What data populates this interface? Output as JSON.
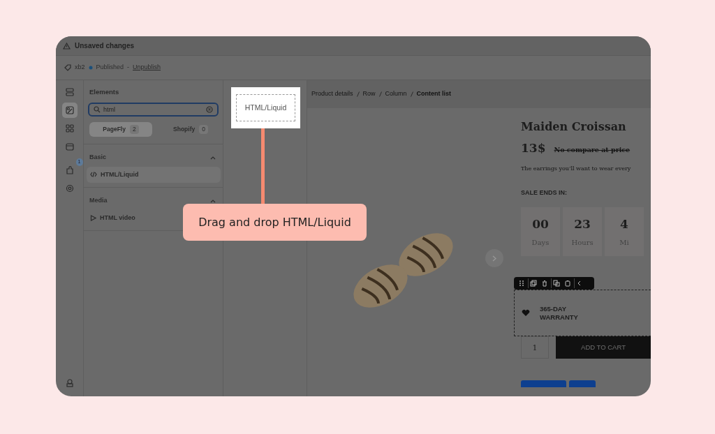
{
  "banner": {
    "title": "Unsaved changes"
  },
  "page_bar": {
    "page_name": "xb2",
    "status": "Published",
    "separator": "-",
    "action": "Unpublish"
  },
  "rail": {
    "items": [
      {
        "selected": false
      },
      {
        "selected": true
      },
      {
        "selected": false
      },
      {
        "selected": false
      },
      {
        "selected": false,
        "badge": "1"
      },
      {
        "selected": false
      }
    ]
  },
  "elements_panel": {
    "title": "Elements",
    "search": {
      "value": "html"
    },
    "filters": [
      {
        "label": "PageFly",
        "count": "2",
        "selected": true
      },
      {
        "label": "Shopify",
        "count": "0",
        "selected": false
      }
    ],
    "groups": [
      {
        "title": "Basic",
        "expanded": true,
        "items": [
          {
            "label": "HTML/Liquid",
            "kind": "code",
            "selected": true
          }
        ]
      },
      {
        "title": "Media",
        "expanded": true,
        "items": [
          {
            "label": "HTML video",
            "kind": "video",
            "selected": false
          }
        ]
      }
    ]
  },
  "drag_preview": {
    "label": "HTML/Liquid"
  },
  "callout": {
    "text": "Drag and drop HTML/Liquid"
  },
  "breadcrumb": [
    {
      "label": "Product details",
      "selected": false
    },
    {
      "label": "Row",
      "selected": false
    },
    {
      "label": "Column",
      "selected": false
    },
    {
      "label": "Content list",
      "selected": true
    }
  ],
  "product": {
    "title": "Maiden Croissan",
    "price": "13$",
    "compare_price": "No compare at price",
    "description": "The earrings you’ll want to wear every",
    "sale_label": "SALE ENDS IN:",
    "countdown": [
      {
        "value": "00",
        "unit": "Days"
      },
      {
        "value": "23",
        "unit": "Hours"
      },
      {
        "value": "4",
        "unit": "Mi"
      }
    ],
    "warranty": "365-DAY WARRANTY",
    "quantity": "1",
    "add_to_cart": "ADD TO CART"
  }
}
